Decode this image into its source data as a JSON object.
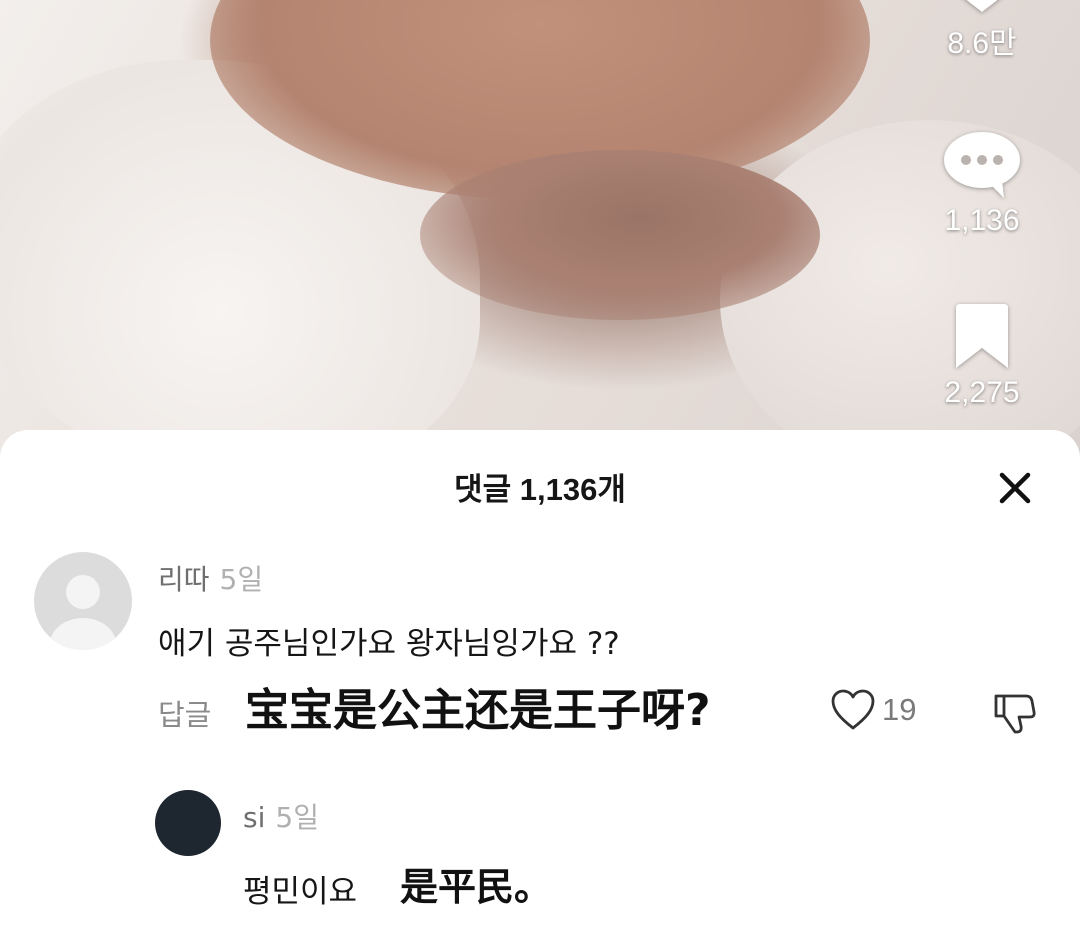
{
  "video": {
    "like_count": "8.6만",
    "comment_count": "1,136",
    "save_count": "2,275"
  },
  "comments_sheet": {
    "title": "댓글 1,136개",
    "comments": [
      {
        "username": "리따",
        "time": "5일",
        "text": "애기 공주님인가요 왕자님잉가요 ??",
        "reply_label": "답글",
        "translation": "宝宝是公主还是王子呀?",
        "like_count": "19"
      }
    ],
    "replies": [
      {
        "username": "si",
        "time": "5일",
        "text": "평민이요",
        "translation": "是平民。"
      }
    ]
  },
  "icons": [
    "heart-icon",
    "comment-bubble-icon",
    "bookmark-icon",
    "close-icon",
    "default-avatar-icon",
    "heart-outline-icon",
    "thumbs-down-icon"
  ],
  "colors": {
    "sheet_background": "#ffffff",
    "primary_text": "#161616",
    "secondary_text": "#6f6f6f",
    "muted_text": "#b0b0b0"
  }
}
